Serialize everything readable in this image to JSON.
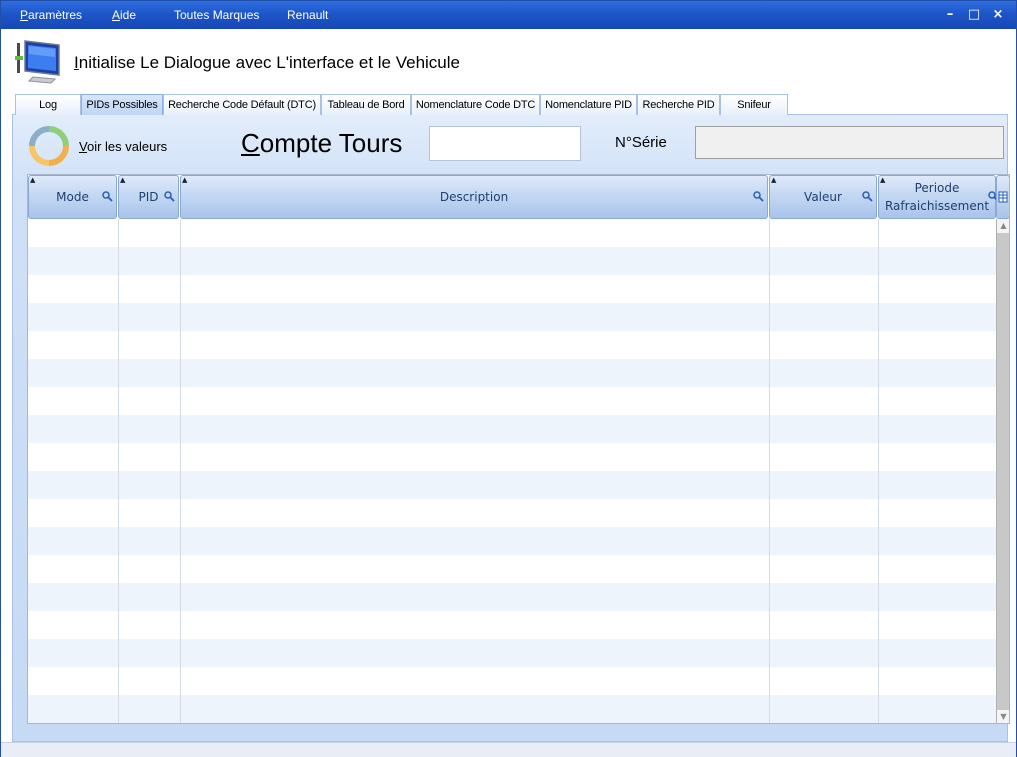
{
  "menu": {
    "parametres": {
      "first": "P",
      "rest": "aramètres"
    },
    "aide": {
      "first": "A",
      "rest": "ide"
    },
    "toutes_marques": "Toutes Marques",
    "renault": "Renault"
  },
  "window_controls": {
    "minimize": "–",
    "maximize": "□",
    "close": "×"
  },
  "header": {
    "title_first": "I",
    "title_rest": "nitialise Le Dialogue avec L'interface et le Vehicule"
  },
  "tabs": [
    {
      "label": "Log",
      "active": false
    },
    {
      "label": "PIDs Possibles",
      "active": true
    },
    {
      "label": "Recherche Code Défault (DTC)",
      "active": false
    },
    {
      "label": "Tableau de Bord",
      "active": false
    },
    {
      "label": "Nomenclature Code DTC",
      "active": false
    },
    {
      "label": "Nomenclature PID",
      "active": false
    },
    {
      "label": "Recherche PID",
      "active": false
    },
    {
      "label": "Snifeur",
      "active": false
    }
  ],
  "toolbar": {
    "voir_first": "V",
    "voir_rest": "oir les valeurs",
    "compte_first": "C",
    "compte_rest": "ompte Tours",
    "compte_value": "",
    "serie_label": "N°Série",
    "serie_value": ""
  },
  "grid": {
    "columns": {
      "mode": "Mode",
      "pid": "PID",
      "description": "Description",
      "valeur": "Valeur",
      "periode_line1": "Periode",
      "periode_line2": "Rafraichissement"
    },
    "rows": []
  },
  "colors": {
    "menubar": "#1d56c9",
    "panel": "#c6daf5",
    "header_cell": "#c4d8f3",
    "header_text": "#1f3f6e",
    "alt_row": "#eef4fc"
  }
}
